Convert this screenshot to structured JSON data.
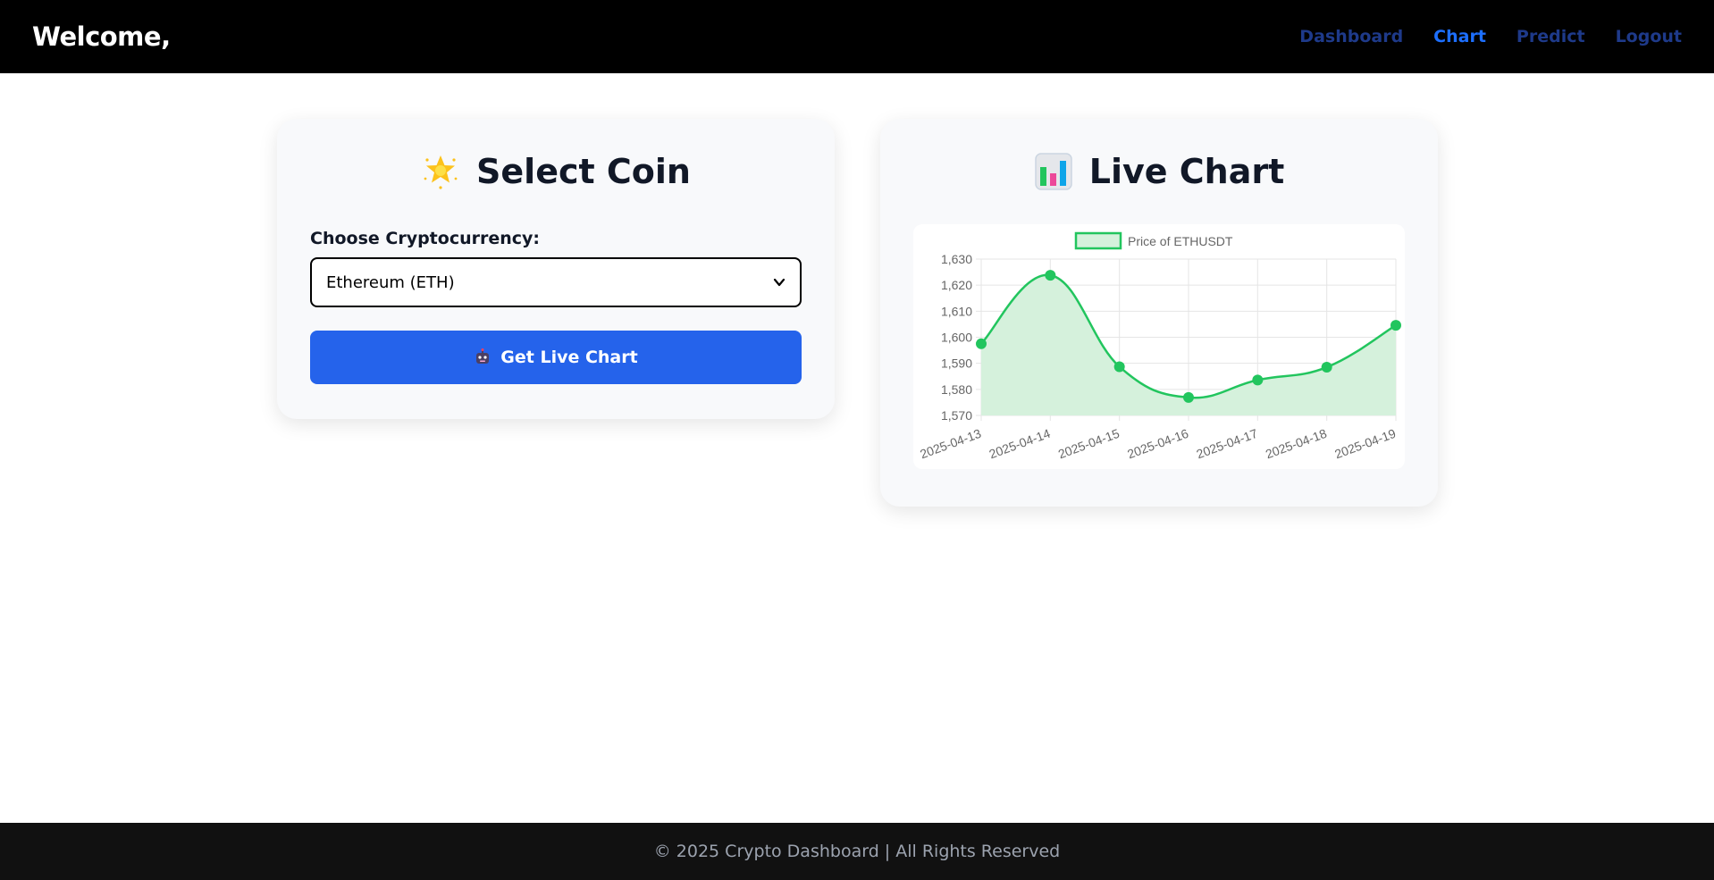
{
  "navbar": {
    "brand": "Welcome,",
    "links": [
      {
        "label": "Dashboard",
        "active": false
      },
      {
        "label": "Chart",
        "active": true
      },
      {
        "label": "Predict",
        "active": false
      },
      {
        "label": "Logout",
        "active": false
      }
    ]
  },
  "select_card": {
    "title": "Select Coin",
    "title_icon": "glowing-star-icon",
    "field_label": "Choose Cryptocurrency:",
    "selected_value": "Ethereum (ETH)",
    "button_icon": "robot-icon",
    "button_label": "Get Live Chart"
  },
  "chart_card": {
    "title": "Live Chart",
    "title_icon": "bar-chart-icon"
  },
  "chart_data": {
    "type": "line",
    "categories": [
      "2025-04-13",
      "2025-04-14",
      "2025-04-15",
      "2025-04-16",
      "2025-04-17",
      "2025-04-18",
      "2025-04-19"
    ],
    "series": [
      {
        "name": "Price of ETHUSDT",
        "values": [
          1597.5,
          1623.8,
          1588.7,
          1576.9,
          1583.6,
          1588.5,
          1604.6
        ]
      }
    ],
    "ylim": [
      1570,
      1630
    ],
    "yticks": [
      "1,630",
      "1,620",
      "1,610",
      "1,600",
      "1,590",
      "1,580",
      "1,570"
    ],
    "ytick_values": [
      1630,
      1620,
      1610,
      1600,
      1590,
      1580,
      1570
    ],
    "grid": true,
    "legend": "top-center",
    "fill": true,
    "line_color": "#22c55e",
    "fill_color": "#d5f1dc"
  },
  "footer": {
    "text": "© 2025 Crypto Dashboard | All Rights Reserved"
  },
  "colors": {
    "navbar_bg": "#000000",
    "nav_link": "#1e3a8a",
    "nav_link_active": "#1d6fff",
    "button_bg": "#2563eb",
    "card_bg": "#f8f9fb",
    "footer_bg": "#111111"
  }
}
